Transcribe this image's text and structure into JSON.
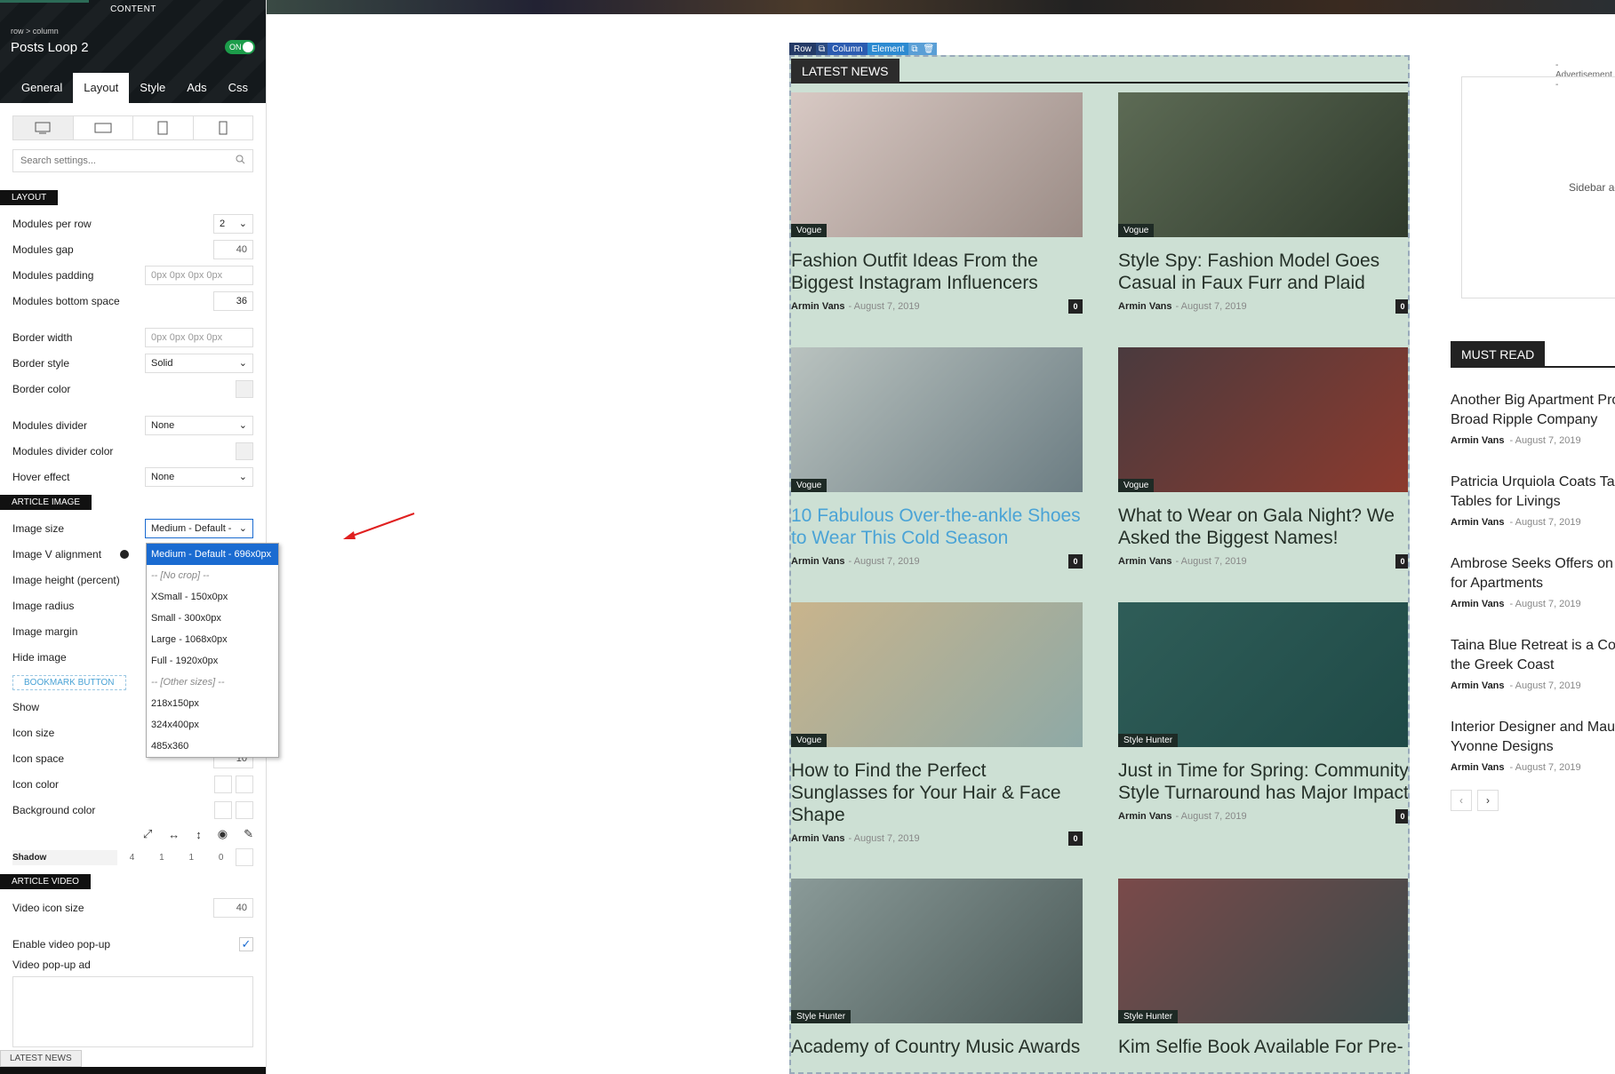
{
  "panel": {
    "content_tab": "CONTENT",
    "breadcrumb": "row > column",
    "title": "Posts Loop 2",
    "toggle": "ON",
    "tabs": [
      "General",
      "Layout",
      "Style",
      "Ads",
      "Css"
    ],
    "active_tab": "Layout",
    "search_placeholder": "Search settings...",
    "sections": {
      "layout": "LAYOUT",
      "article_image": "ARTICLE IMAGE",
      "bookmark": "BOOKMARK BUTTON",
      "article_video": "ARTICLE VIDEO"
    },
    "layout": {
      "modules_per_row_label": "Modules per row",
      "modules_per_row": "2",
      "modules_gap_label": "Modules gap",
      "modules_gap": "40",
      "modules_padding_label": "Modules padding",
      "modules_padding": "0px 0px 0px 0px",
      "modules_bottom_space_label": "Modules bottom space",
      "modules_bottom_space": "36",
      "border_width_label": "Border width",
      "border_width": "0px 0px 0px 0px",
      "border_style_label": "Border style",
      "border_style": "Solid",
      "border_color_label": "Border color",
      "modules_divider_label": "Modules divider",
      "modules_divider": "None",
      "modules_divider_color_label": "Modules divider color",
      "hover_effect_label": "Hover effect",
      "hover_effect": "None"
    },
    "image": {
      "size_label": "Image size",
      "size": "Medium - Default - ",
      "v_align_label": "Image V alignment",
      "height_label": "Image height (percent)",
      "radius_label": "Image radius",
      "margin_label": "Image margin",
      "hide_label": "Hide image"
    },
    "image_size_options": [
      {
        "label": "Medium - Default - 696x0px",
        "type": "selected"
      },
      {
        "label": "-- [No crop] --",
        "type": "group"
      },
      {
        "label": "XSmall - 150x0px",
        "type": "option"
      },
      {
        "label": "Small - 300x0px",
        "type": "option"
      },
      {
        "label": "Large - 1068x0px",
        "type": "option"
      },
      {
        "label": "Full - 1920x0px",
        "type": "option"
      },
      {
        "label": "-- [Other sizes] --",
        "type": "group"
      },
      {
        "label": "218x150px",
        "type": "option"
      },
      {
        "label": "324x400px",
        "type": "option"
      },
      {
        "label": "485x360",
        "type": "option"
      }
    ],
    "bookmark": {
      "show_label": "Show",
      "icon_size_label": "Icon size",
      "icon_space_label": "Icon space",
      "icon_space": "10",
      "icon_color_label": "Icon color",
      "bg_color_label": "Background color",
      "shadow_label": "Shadow",
      "shadow_values": [
        "4",
        "1",
        "1",
        "0"
      ]
    },
    "video": {
      "icon_size_label": "Video icon size",
      "icon_size": "40",
      "popup_label": "Enable video pop-up",
      "popup_ad_label": "Video pop-up ad"
    },
    "bottom_tab": "LATEST NEWS"
  },
  "editbar": {
    "row": "Row",
    "column": "Column",
    "element": "Element"
  },
  "latest_news": "LATEST NEWS",
  "articles": [
    {
      "cat": "Vogue",
      "title": "Fashion Outfit Ideas From the Biggest Instagram Influencers",
      "author": "Armin Vans",
      "date": "- August 7, 2019",
      "count": "0",
      "c1": "#d8c9c4",
      "c2": "#9b8c86"
    },
    {
      "cat": "Vogue",
      "title": "Style Spy: Fashion Model Goes Casual in Faux Furr and Plaid",
      "author": "Armin Vans",
      "date": "- August 7, 2019",
      "count": "0",
      "c1": "#5d6b55",
      "c2": "#2f3a2c"
    },
    {
      "cat": "Vogue",
      "title": "10 Fabulous Over-the-ankle Shoes to Wear This Cold Season",
      "author": "Armin Vans",
      "date": "- August 7, 2019",
      "count": "0",
      "c1": "#b9c2bf",
      "c2": "#6c7d83"
    },
    {
      "cat": "Vogue",
      "title": "What to Wear on Gala Night? We Asked the Biggest Names!",
      "author": "Armin Vans",
      "date": "- August 7, 2019",
      "count": "0",
      "c1": "#4a3a3e",
      "c2": "#8c3a2e"
    },
    {
      "cat": "Vogue",
      "title": "How to Find the Perfect Sunglasses for Your Hair & Face Shape",
      "author": "Armin Vans",
      "date": "- August 7, 2019",
      "count": "0",
      "c1": "#c9b48c",
      "c2": "#8ea9a6"
    },
    {
      "cat": "Style Hunter",
      "title": "Just in Time for Spring: Community Style Turnaround has Major Impact",
      "author": "Armin Vans",
      "date": "- August 7, 2019",
      "count": "0",
      "c1": "#2f5d58",
      "c2": "#1f4a47"
    },
    {
      "cat": "Style Hunter",
      "title": "Academy of Country Music Awards",
      "author": "",
      "date": "",
      "count": "",
      "c1": "#8a9a98",
      "c2": "#4b5a58"
    },
    {
      "cat": "Style Hunter",
      "title": "Kim Selfie Book Available For Pre-",
      "author": "",
      "date": "",
      "count": "",
      "c1": "#7a4a4a",
      "c2": "#3a4a4a"
    }
  ],
  "sidebar": {
    "advert": "- Advertisement -",
    "ad_text": "Sidebar ad",
    "must_read": "MUST READ",
    "items": [
      {
        "l1": "Another Big Apartment Project",
        "l2": "Broad Ripple Company",
        "author": "Armin Vans",
        "date": "- August 7, 2019"
      },
      {
        "l1": "Patricia Urquiola Coats Tables",
        "l2": "Tables for Livings",
        "author": "Armin Vans",
        "date": "- August 7, 2019"
      },
      {
        "l1": "Ambrose Seeks Offers on",
        "l2": "for Apartments",
        "author": "Armin Vans",
        "date": "- August 7, 2019"
      },
      {
        "l1": "Taina Blue Retreat is a Com",
        "l2": "the Greek Coast",
        "author": "Armin Vans",
        "date": "- August 7, 2019"
      },
      {
        "l1": "Interior Designer and Mau",
        "l2": "Yvonne Designs",
        "author": "Armin Vans",
        "date": "- August 7, 2019"
      }
    ]
  },
  "colors": {
    "accent": "#1a6bd1",
    "link": "#4aa3d6",
    "module_bg": "#cde0d4"
  }
}
